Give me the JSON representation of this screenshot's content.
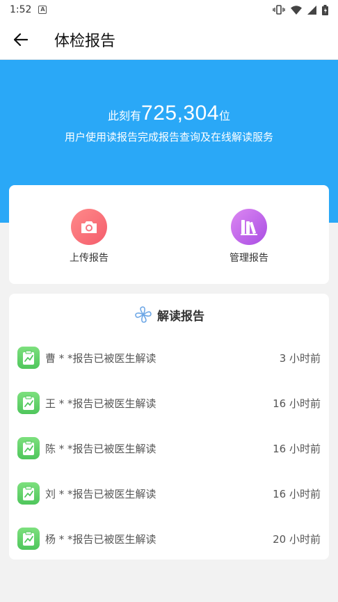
{
  "status_bar": {
    "time": "1:52",
    "notif_letter": "A"
  },
  "header": {
    "title": "体检报告"
  },
  "banner": {
    "prefix": "此刻有",
    "count": "725,304",
    "suffix": "位",
    "subtitle": "用户使用读报告完成报告查询及在线解读服务",
    "color": "#2aa8f7"
  },
  "actions": [
    {
      "label": "上传报告",
      "icon": "camera-icon"
    },
    {
      "label": "管理报告",
      "icon": "books-icon"
    }
  ],
  "list": {
    "title": "解读报告",
    "title_icon": "pinwheel-icon",
    "items": [
      {
        "text": "曹 * *报告已被医生解读",
        "ago": "3 小时前"
      },
      {
        "text": "王 * *报告已被医生解读",
        "ago": "16 小时前"
      },
      {
        "text": "陈 * *报告已被医生解读",
        "ago": "16 小时前"
      },
      {
        "text": "刘 * *报告已被医生解读",
        "ago": "16 小时前"
      },
      {
        "text": "杨 * *报告已被医生解读",
        "ago": "20 小时前"
      }
    ]
  }
}
